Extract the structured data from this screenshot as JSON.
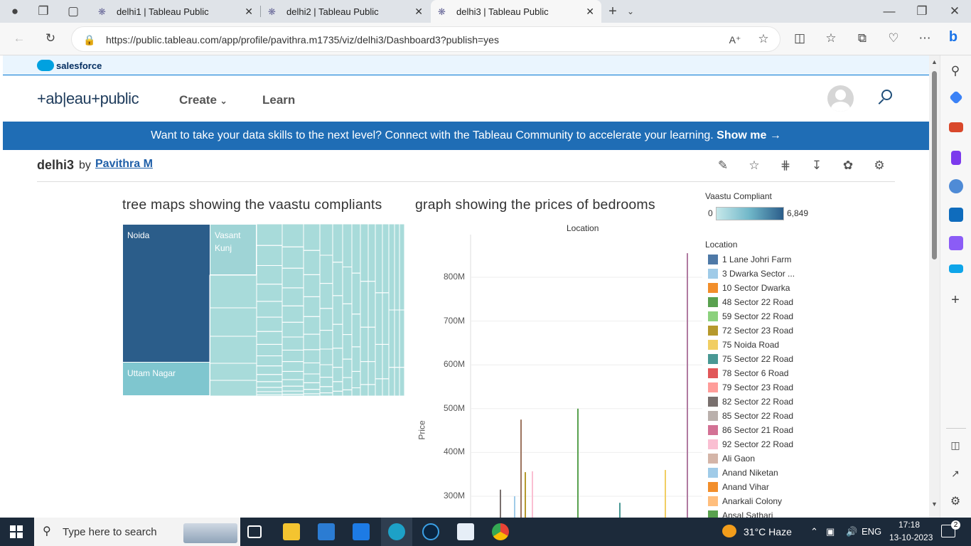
{
  "browser": {
    "tabs": [
      {
        "title": "delhi1 | Tableau Public"
      },
      {
        "title": "delhi2 | Tableau Public"
      },
      {
        "title": "delhi3 | Tableau Public"
      }
    ],
    "url": "https://public.tableau.com/app/profile/pavithra.m1735/viz/delhi3/Dashboard3?publish=yes"
  },
  "site": {
    "salesforce_label": "salesforce",
    "logo": "+ab|eau+public",
    "nav": {
      "create": "Create",
      "learn": "Learn"
    },
    "banner_text": "Want to take your data skills to the next level? Connect with the Tableau Community to accelerate your learning.",
    "banner_link": "Show me →"
  },
  "viz": {
    "title": "delhi3",
    "by": "by",
    "author": "Pavithra M"
  },
  "dashboard": {
    "treemap_title": "tree maps showing the vaastu compliants",
    "treemap_labels": {
      "noida": "Noida",
      "vasant_kunj": "Vasant Kunj",
      "uttam_nagar": "Uttam Nagar"
    },
    "graph_title": "graph showing the prices of bedrooms",
    "graph_header": "Location",
    "y_axis_label": "Price",
    "vaastu_legend": {
      "title": "Vaastu Compliant",
      "min": "0",
      "max": "6,849"
    },
    "location_legend_title": "Location",
    "location_legend": [
      {
        "label": "1 Lane Johri Farm",
        "color": "#4e79a7"
      },
      {
        "label": "3 Dwarka Sector ...",
        "color": "#a0cbe8"
      },
      {
        "label": "10 Sector Dwarka",
        "color": "#f28e2b"
      },
      {
        "label": "48 Sector 22 Road",
        "color": "#59a14f"
      },
      {
        "label": "59 Sector 22 Road",
        "color": "#8cd17d"
      },
      {
        "label": "72 Sector 23 Road",
        "color": "#b6992d"
      },
      {
        "label": "75 Noida Road",
        "color": "#f1ce63"
      },
      {
        "label": "75 Sector 22 Road",
        "color": "#499894"
      },
      {
        "label": "78 Sector 6 Road",
        "color": "#e15759"
      },
      {
        "label": "79 Sector 23 Road",
        "color": "#ff9d9a"
      },
      {
        "label": "82 Sector 22 Road",
        "color": "#79706e"
      },
      {
        "label": "85 Sector 22 Road",
        "color": "#bab0ac"
      },
      {
        "label": "86 Sector 21 Road",
        "color": "#d37295"
      },
      {
        "label": "92 Sector 22 Road",
        "color": "#fabfd2"
      },
      {
        "label": "Ali Gaon",
        "color": "#d4b5a8"
      },
      {
        "label": "Anand Niketan",
        "color": "#a0cbe8"
      },
      {
        "label": "Anand Vihar",
        "color": "#f28e2b"
      },
      {
        "label": "Anarkali Colony",
        "color": "#ffbe7d"
      },
      {
        "label": "Ansal Sathari",
        "color": "#59a14f"
      }
    ]
  },
  "chart_data": {
    "type": "bar",
    "title": "graph showing the prices of bedrooms",
    "xlabel": "Location",
    "ylabel": "Price",
    "y_ticks": [
      "300M",
      "400M",
      "500M",
      "600M",
      "700M",
      "800M"
    ],
    "ylim": [
      240000000,
      860000000
    ],
    "series": [
      {
        "color": "#79706e",
        "values": [
          315000000
        ]
      },
      {
        "color": "#a0cbe8",
        "values": [
          300000000
        ]
      },
      {
        "color": "#9c755f",
        "values": [
          475000000
        ]
      },
      {
        "color": "#b6992d",
        "values": [
          355000000
        ]
      },
      {
        "color": "#fabfd2",
        "values": [
          357000000
        ]
      },
      {
        "color": "#59a14f",
        "values": [
          500000000
        ]
      },
      {
        "color": "#499894",
        "values": [
          285000000
        ]
      },
      {
        "color": "#f1ce63",
        "values": [
          360000000
        ]
      },
      {
        "color": "#b07aa1",
        "values": [
          855000000
        ]
      }
    ]
  },
  "taskbar": {
    "search_placeholder": "Type here to search",
    "weather": "31°C  Haze",
    "lang": "ENG",
    "time": "17:18",
    "date": "13-10-2023",
    "notif": "2"
  }
}
